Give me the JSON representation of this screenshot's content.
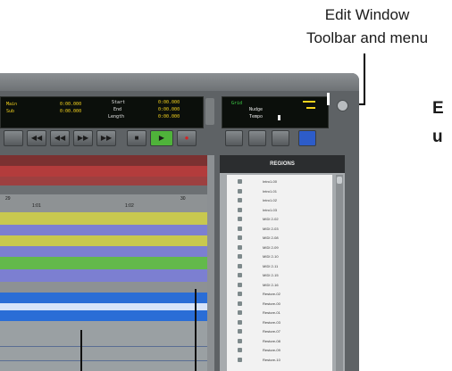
{
  "annotations": {
    "top_line1": "Edit Window",
    "top_line2": "Toolbar and menu",
    "right_line1": "E",
    "right_line2": "u"
  },
  "counters": {
    "main_label1": "Main",
    "main_label2": "Sub",
    "main_value": "0:00.000",
    "sub_value": "0:00.000",
    "start_label": "Start",
    "end_label": "End",
    "length_label": "Length",
    "start_value": "0:00.000",
    "end_value": "0:00.000",
    "length_value": "0:00.000"
  },
  "grid_panel": {
    "grid_label": "Grid",
    "nudge_label": "Nudge",
    "tempo_label": "Tempo",
    "grid_value": "",
    "nudge_value": "",
    "tempo_value": ""
  },
  "timeline": {
    "ruler_left": "29",
    "mark1": "1:01",
    "mark2": "1:02",
    "ruler_right": "30"
  },
  "regions": {
    "header": "REGIONS",
    "items": [
      "Intro1-00",
      "Intro1-01",
      "Intro1-02",
      "Intro1-03",
      "MIDI 2-02",
      "MIDI 2-03",
      "MIDI 2-08",
      "MIDI 2-09",
      "MIDI 2-10",
      "MIDI 2-11",
      "MIDI 2-15",
      "MIDI 2-16",
      "Restore-02",
      "Restore-00",
      "Restore-01",
      "Restore-03",
      "Restore-07",
      "Restore-08",
      "Restore-09",
      "Restore-10"
    ]
  },
  "colors": {
    "window_bg": "#5e6265",
    "lcd_bg": "#0b0f0b",
    "lcd_amber": "#f3d21d",
    "lcd_green": "#41d94a",
    "play_button": "#4fb33a",
    "record_button": "#d42424",
    "regions_panel": "#a7abae",
    "wave_blue": "#2a6dd6",
    "track_red": "#b33c3c",
    "track_yellow": "#c8c84f",
    "track_purple": "#7c7fd1",
    "track_green": "#63b94b"
  },
  "icons": [
    "window-menu-icon",
    "rewind-icon",
    "back-icon",
    "play-icon",
    "stop-icon",
    "record-icon",
    "zoom-icon",
    "grab-icon",
    "pencil-icon",
    "select-icon"
  ]
}
